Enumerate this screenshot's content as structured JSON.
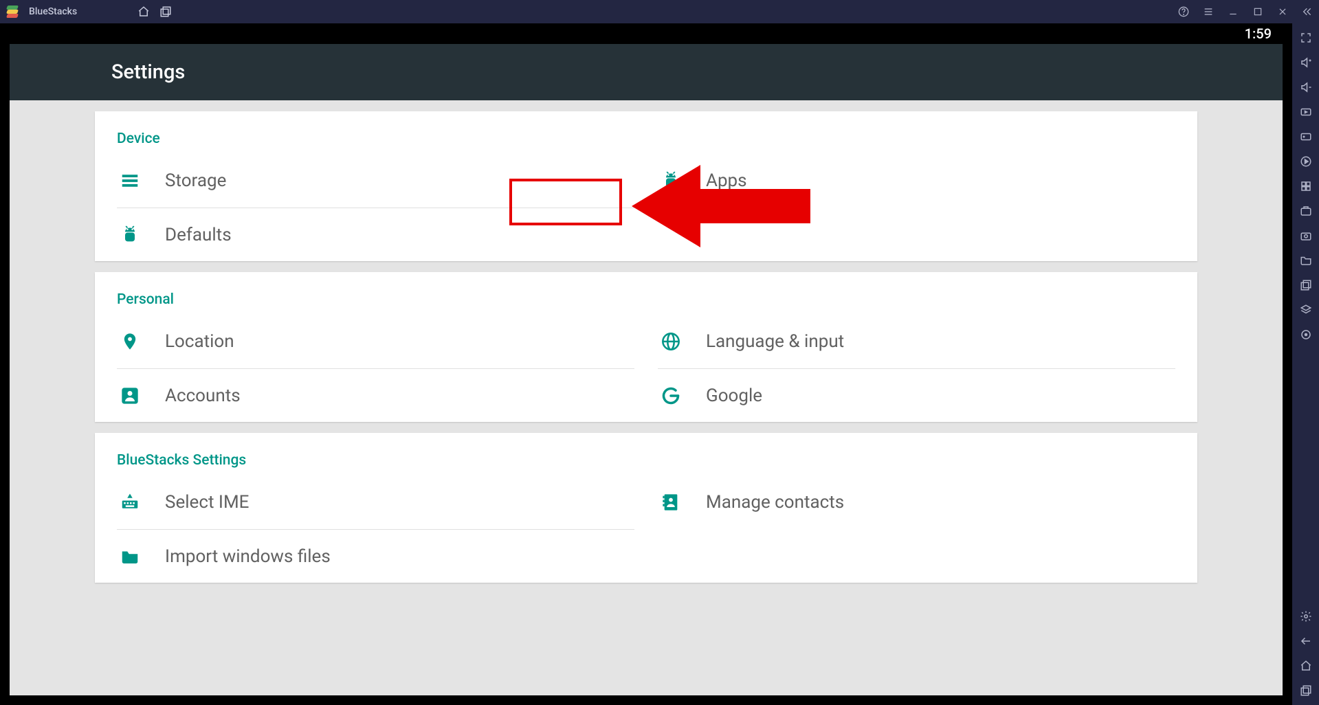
{
  "app": {
    "name": "BlueStacks"
  },
  "statusbar": {
    "time": "1:59"
  },
  "page": {
    "title": "Settings"
  },
  "sections": {
    "device": {
      "title": "Device",
      "storage": "Storage",
      "apps": "Apps",
      "defaults": "Defaults"
    },
    "personal": {
      "title": "Personal",
      "location": "Location",
      "language": "Language & input",
      "accounts": "Accounts",
      "google": "Google"
    },
    "bluestacks": {
      "title": "BlueStacks Settings",
      "ime": "Select IME",
      "contacts": "Manage contacts",
      "import": "Import windows files"
    }
  },
  "colors": {
    "accent": "#009688",
    "titlebar": "#232642",
    "arrow": "#e60000"
  }
}
